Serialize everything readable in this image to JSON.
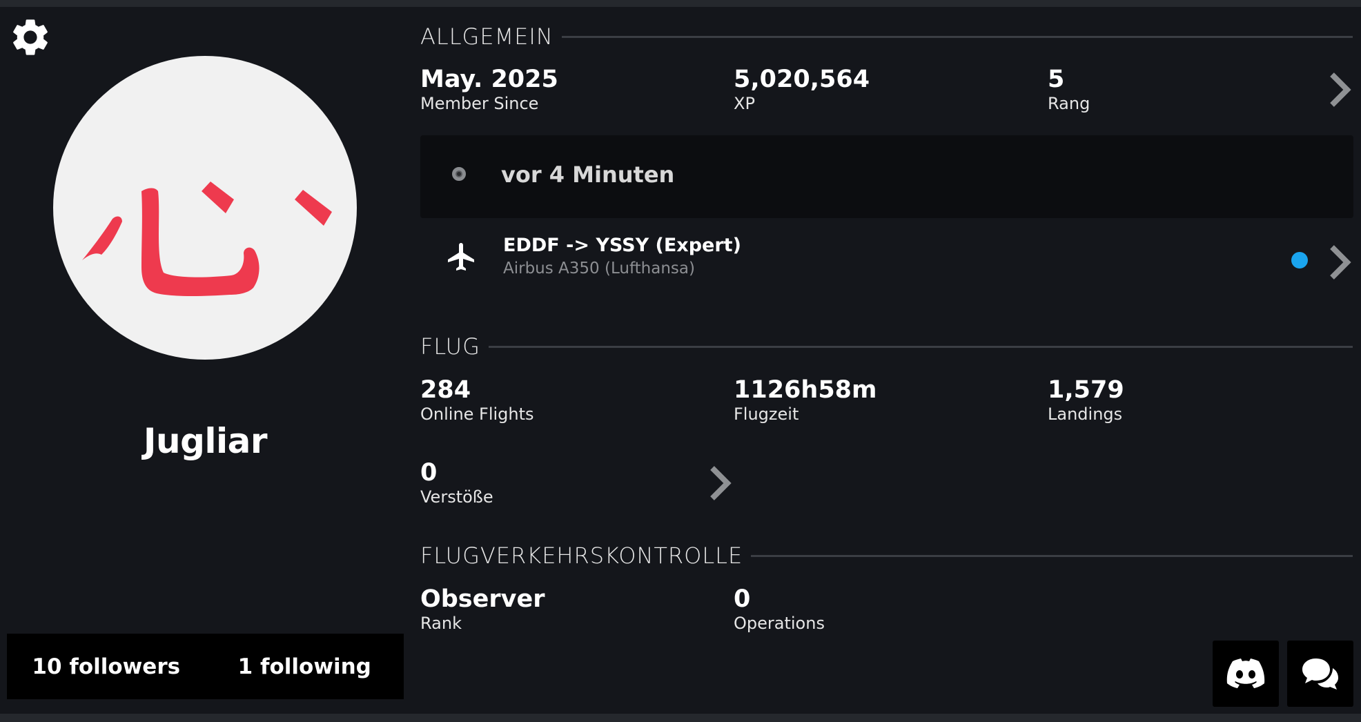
{
  "profile": {
    "username": "Jugliar",
    "followers_label": "10 followers",
    "following_label": "1 following",
    "avatar": {
      "glyph": "心",
      "color": "#ee3a4e"
    }
  },
  "general": {
    "title": "ALLGEMEIN",
    "member_since_value": "May. 2025",
    "member_since_label": "Member Since",
    "xp_value": "5,020,564",
    "xp_label": "XP",
    "rank_value": "5",
    "rank_label": "Rang"
  },
  "status": {
    "text": "vor 4 Minuten"
  },
  "flight": {
    "route": "EDDF -> YSSY (Expert)",
    "aircraft": "Airbus A350 (Lufthansa)",
    "live_color": "#1aa4ee",
    "icon": "airplane-icon"
  },
  "flug": {
    "title": "FLUG",
    "online_flights_value": "284",
    "online_flights_label": "Online Flights",
    "flight_time_value": "1126h58m",
    "flight_time_label": "Flugzeit",
    "landings_value": "1,579",
    "landings_label": "Landings",
    "violations_value": "0",
    "violations_label": "Verstöße"
  },
  "atc": {
    "title": "FLUGVERKEHRSKONTROLLE",
    "rank_value": "Observer",
    "rank_label": "Rank",
    "operations_value": "0",
    "operations_label": "Operations"
  },
  "icons": {
    "settings": "gear-icon",
    "discord": "discord-icon",
    "chat": "chat-icon",
    "chevron": "chevron-right-icon"
  },
  "colors": {
    "background": "#14161b",
    "card": "#0c0d10",
    "accent_live": "#1aa4ee",
    "avatar_glyph": "#ee3a4e"
  }
}
